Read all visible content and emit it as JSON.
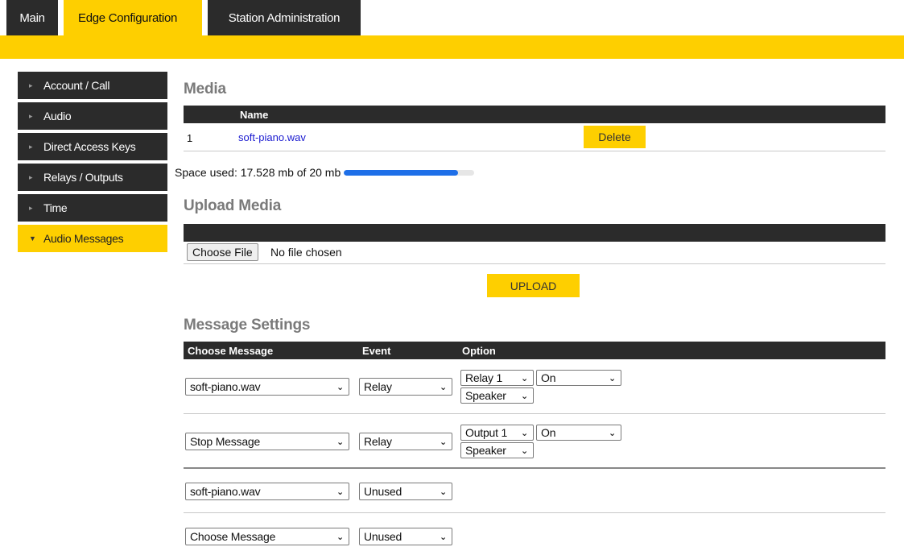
{
  "tabs": [
    "Main",
    "Edge Configuration",
    "Station Administration"
  ],
  "sidebar": [
    "Account / Call",
    "Audio",
    "Direct Access Keys",
    "Relays / Outputs",
    "Time",
    "Audio Messages"
  ],
  "media": {
    "title": "Media",
    "col_name": "Name",
    "row": {
      "num": "1",
      "file": "soft-piano.wav",
      "delete_label": "Delete"
    },
    "space_text": "Space used: 17.528 mb of 20 mb",
    "space_used_fraction": 0.876
  },
  "upload": {
    "title": "Upload Media",
    "choose_file_label": "Choose File",
    "no_file_text": "No file chosen",
    "upload_label": "UPLOAD"
  },
  "settings": {
    "title": "Message Settings",
    "col_message": "Choose Message",
    "col_event": "Event",
    "col_option": "Option",
    "rows": [
      {
        "message": "soft-piano.wav",
        "event": "Relay",
        "opt1": "Relay 1",
        "opt2": "On",
        "opt3": "Speaker"
      },
      {
        "message": "Stop Message",
        "event": "Relay",
        "opt1": "Output 1",
        "opt2": "On",
        "opt3": "Speaker"
      },
      {
        "message": "soft-piano.wav",
        "event": "Unused"
      },
      {
        "message": "Choose Message",
        "event": "Unused"
      }
    ]
  },
  "colors": {
    "accent": "#fecf00",
    "dark": "#2b2b2b",
    "link": "#1a1ad0",
    "progress": "#1e6fe8"
  },
  "icons": {
    "sidebar_collapsed": "chevron-right-icon",
    "sidebar_expanded": "chevron-down-icon",
    "select_arrow": "chevron-down-icon"
  }
}
